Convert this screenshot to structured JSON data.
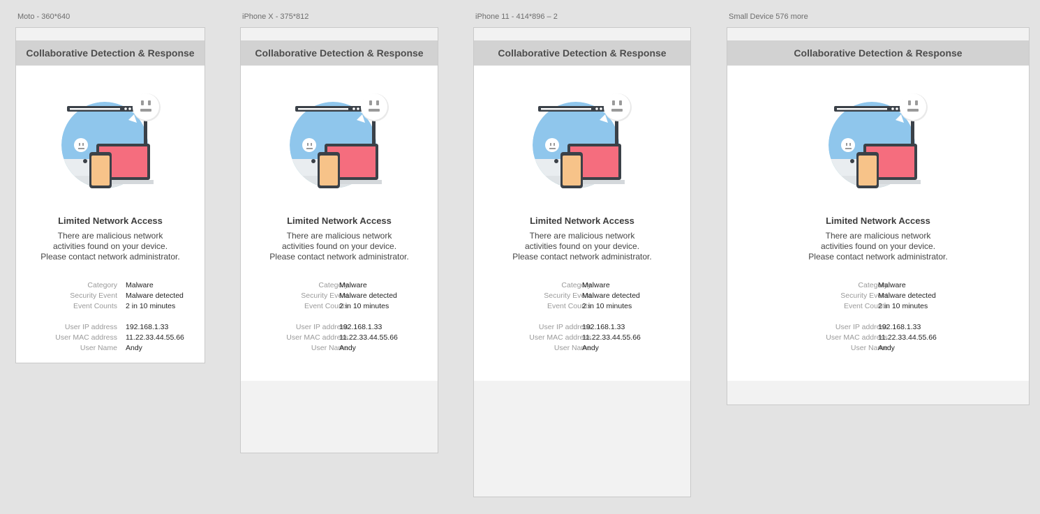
{
  "artboards": [
    {
      "label": "Moto - 360*640"
    },
    {
      "label": "iPhone X - 375*812"
    },
    {
      "label": "iPhone 11 - 414*896 – 2"
    },
    {
      "label": "Small Device 576 more"
    }
  ],
  "screen": {
    "header_title": "Collaborative Detection & Response",
    "title": "Limited Network Access",
    "desc_lines": [
      "There are malicious network",
      "activities found on your device.",
      "Please contact network administrator."
    ],
    "details_group1": [
      {
        "label": "Category",
        "value": "Malware"
      },
      {
        "label": "Security Event",
        "value": "Malware detected"
      },
      {
        "label": "Event Counts",
        "value": "2 in 10 minutes"
      }
    ],
    "details_group2": [
      {
        "label": "User IP address",
        "value": "192.168.1.33"
      },
      {
        "label": "User MAC address",
        "value": "11.22.33.44.55.66"
      },
      {
        "label": "User Name",
        "value": "Andy"
      }
    ]
  },
  "colors": {
    "illus_circle_blue": "#8fc6ec",
    "illus_circle_teal": "#6fb9bf",
    "illus_laptop": "#f56d7e",
    "illus_phone": "#f7c389",
    "illus_outline": "#3b4148"
  },
  "illustration_icon": "devices-network-illustration"
}
